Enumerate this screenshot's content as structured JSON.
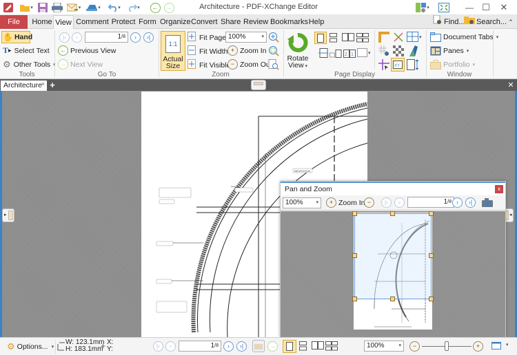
{
  "window": {
    "title": "Architecture - PDF-XChange Editor",
    "controls": {
      "minimize": "—",
      "maximize": "☐",
      "close": "✕"
    }
  },
  "quick_access": {
    "icons": [
      "app-logo-icon",
      "open-folder-icon",
      "save-icon",
      "print-icon",
      "email-icon",
      "scan-icon",
      "undo-icon",
      "redo-icon",
      "back-icon",
      "forward-icon"
    ]
  },
  "menu": {
    "items": [
      "File",
      "Home",
      "View",
      "Comment",
      "Protect",
      "Form",
      "Organize",
      "Convert",
      "Share",
      "Review",
      "Bookmarks",
      "Help"
    ],
    "active": "View",
    "find_label": "Find...",
    "search_label": "Search..."
  },
  "ribbon": {
    "tools": {
      "label": "Tools",
      "hand": "Hand",
      "select_text": "Select Text",
      "other_tools": "Other Tools"
    },
    "goto": {
      "label": "Go To",
      "page_value": "1",
      "page_total": "/8",
      "previous_view": "Previous View",
      "next_view": "Next View"
    },
    "zoom": {
      "label": "Zoom",
      "actual_size_line1": "Actual",
      "actual_size_line2": "Size",
      "actual_glyph": "1:1",
      "fit_page": "Fit Page",
      "fit_width": "Fit Width",
      "fit_visible": "Fit Visible",
      "zoom_value": "100%",
      "zoom_in": "Zoom In",
      "zoom_out": "Zoom Out"
    },
    "page_display": {
      "label": "Page Display",
      "rotate_line1": "Rotate",
      "rotate_line2": "View"
    },
    "window": {
      "label": "Window",
      "document_tabs": "Document Tabs",
      "panes": "Panes",
      "portfolio": "Portfolio"
    }
  },
  "tabs": {
    "documents": [
      {
        "label": "Architecture",
        "close": "×"
      }
    ],
    "add": "+",
    "close_all": "✕"
  },
  "document": {
    "labels": [
      "BEDROOMS"
    ]
  },
  "pan_zoom": {
    "title": "Pan and Zoom",
    "close": "x",
    "zoom_value": "100%",
    "zoom_in": "Zoom In",
    "page_value": "1",
    "page_total": "/8"
  },
  "status": {
    "options": "Options...",
    "width": "W: 123.1mm",
    "height": "H: 183.1mm",
    "x": "X:",
    "y": "Y:",
    "page_value": "1",
    "page_total": "/8",
    "zoom_value": "100%",
    "zoom_slider_fraction": 0.5
  },
  "colors": {
    "file_tab": "#c9464a",
    "accent_blue": "#2e6db0",
    "highlight": "#fde7a8"
  }
}
